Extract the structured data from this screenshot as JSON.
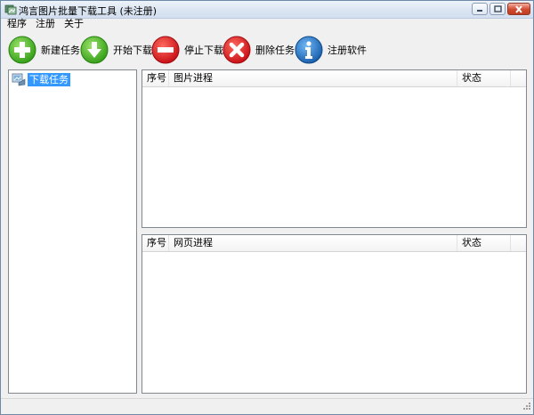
{
  "window": {
    "title": "鸿言图片批量下载工具 (未注册)",
    "caption_buttons": [
      "minimize",
      "maximize",
      "close"
    ]
  },
  "menu": {
    "items": [
      "程序",
      "注册",
      "关于"
    ]
  },
  "toolbar": {
    "buttons": [
      {
        "label": "新建任务",
        "icon": "add-icon",
        "color": "#3cae1e"
      },
      {
        "label": "开始下载",
        "icon": "download-arrow-icon",
        "color": "#3cae1e"
      },
      {
        "label": "停止下载",
        "icon": "stop-icon",
        "color": "#d9101a"
      },
      {
        "label": "删除任务",
        "icon": "delete-x-icon",
        "color": "#d9101a"
      },
      {
        "label": "注册软件",
        "icon": "info-icon",
        "color": "#1a6fc4"
      }
    ]
  },
  "tree": {
    "items": [
      {
        "label": "下载任务",
        "icon": "tasks-icon",
        "selected": true
      }
    ]
  },
  "image_list": {
    "columns": [
      "序号",
      "图片进程",
      "状态",
      ""
    ],
    "rows": []
  },
  "page_list": {
    "columns": [
      "序号",
      "网页进程",
      "状态",
      ""
    ],
    "rows": []
  },
  "colors": {
    "selection": "#3399ff",
    "window_bg": "#f0f0f0"
  }
}
